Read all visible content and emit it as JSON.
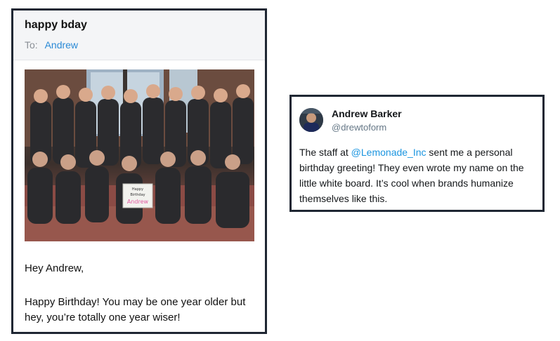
{
  "email": {
    "subject": "happy bday",
    "to_label": "To:",
    "to_name": "Andrew",
    "photo_whiteboard_lines": [
      "Happy",
      "Birthday",
      "Andrew"
    ],
    "greeting": "Hey Andrew,",
    "message": "Happy Birthday! You may be one year older but hey, you’re totally one year wiser!"
  },
  "tweet": {
    "author_name": "Andrew Barker",
    "handle": "@drewtoform",
    "text_before": "The staff at ",
    "mention": "@Lemonade_Inc",
    "text_after": " sent me a personal birthday greeting! They even wrote my name on the little white board. It’s cool when brands humanize themselves like this."
  },
  "colors": {
    "card_border": "#1f2733",
    "link_blue": "#2b8ad6",
    "mention_blue": "#1b95e0",
    "header_bg": "#f4f5f7"
  }
}
